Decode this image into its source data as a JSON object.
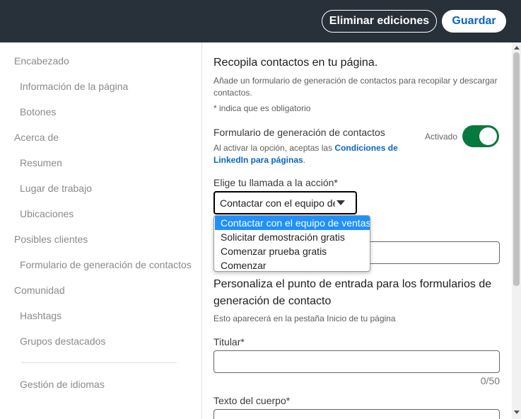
{
  "header": {
    "discard_label": "Eliminar ediciones",
    "save_label": "Guardar"
  },
  "sidebar": {
    "groups": [
      {
        "label": "Encabezado",
        "items": [
          "Información de la página",
          "Botones"
        ]
      },
      {
        "label": "Acerca de",
        "items": [
          "Resumen",
          "Lugar de trabajo",
          "Ubicaciones"
        ]
      },
      {
        "label": "Posibles clientes",
        "items": [
          "Formulario de generación de contactos"
        ]
      },
      {
        "label": "Comunidad",
        "items": [
          "Hashtags",
          "Grupos destacados"
        ]
      }
    ],
    "footer_item": "Gestión de idiomas"
  },
  "main": {
    "section_title": "Recopila contactos en tu página.",
    "section_description": "Añade un formulario de generación de contactos para recopilar y descargar contactos.",
    "required_note": "*  indica que es obligatorio",
    "form_toggle": {
      "label": "Formulario de generación de contactos",
      "note_prefix": "Al activar la opción, aceptas las ",
      "note_link": "Condiciones de LinkedIn para páginas",
      "note_suffix": ".",
      "state_label": "Activado",
      "enabled": true
    },
    "cta": {
      "label": "Elige tu llamada a la acción*",
      "selected_value": "Contactar con el equipo de ventas",
      "options": [
        "Contactar con el equipo de ventas",
        "Solicitar demostración gratis",
        "Comenzar prueba gratis",
        "Comenzar"
      ],
      "selected_index": 0
    },
    "entry_point": {
      "title": "Personaliza el punto de entrada para los formularios de generación de contacto",
      "description": "Esto aparecerá en la pestaña Inicio de tu página"
    },
    "headline": {
      "label": "Titular*",
      "value": "",
      "counter": "0/50"
    },
    "body_text": {
      "label": "Texto del cuerpo*"
    }
  },
  "colors": {
    "topbar": "#283039",
    "brand_blue": "#0a66c2",
    "toggle_on": "#067a3d",
    "option_highlight": "#1e90ff"
  }
}
